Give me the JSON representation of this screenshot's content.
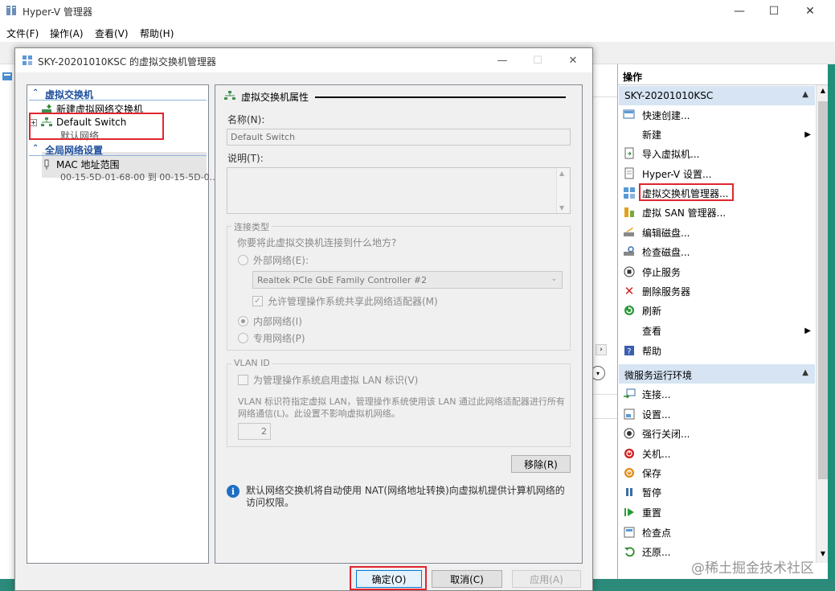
{
  "main_window": {
    "title": "Hyper-V 管理器",
    "menu": [
      "文件(F)",
      "操作(A)",
      "查看(V)",
      "帮助(H)"
    ],
    "controls": {
      "minimize": "—",
      "maximize": "☐",
      "close": "✕"
    }
  },
  "actions": {
    "header": "操作",
    "server_section": "SKY-20201010KSC",
    "server_items": [
      {
        "label": "快速创建...",
        "icon": "quick-create-icon",
        "submenu": false
      },
      {
        "label": "新建",
        "icon": "",
        "submenu": true
      },
      {
        "label": "导入虚拟机...",
        "icon": "import-icon",
        "submenu": false
      },
      {
        "label": "Hyper-V 设置...",
        "icon": "settings-doc-icon",
        "submenu": false
      },
      {
        "label": "虚拟交换机管理器...",
        "icon": "switch-manager-icon",
        "submenu": false
      },
      {
        "label": "虚拟 SAN 管理器...",
        "icon": "san-manager-icon",
        "submenu": false
      },
      {
        "label": "编辑磁盘...",
        "icon": "edit-disk-icon",
        "submenu": false
      },
      {
        "label": "检查磁盘...",
        "icon": "inspect-disk-icon",
        "submenu": false
      },
      {
        "label": "停止服务",
        "icon": "stop-service-icon",
        "submenu": false
      },
      {
        "label": "删除服务器",
        "icon": "delete-server-icon",
        "submenu": false
      },
      {
        "label": "刷新",
        "icon": "refresh-icon",
        "submenu": false
      },
      {
        "label": "查看",
        "icon": "",
        "submenu": true
      },
      {
        "label": "帮助",
        "icon": "help-icon",
        "submenu": false
      }
    ],
    "vm_section": "微服务运行环境",
    "vm_items": [
      {
        "label": "连接...",
        "icon": "connect-icon"
      },
      {
        "label": "设置...",
        "icon": "settings-icon"
      },
      {
        "label": "强行关闭...",
        "icon": "turn-off-icon"
      },
      {
        "label": "关机...",
        "icon": "shutdown-icon"
      },
      {
        "label": "保存",
        "icon": "save-icon"
      },
      {
        "label": "暂停",
        "icon": "pause-icon"
      },
      {
        "label": "重置",
        "icon": "reset-icon"
      },
      {
        "label": "检查点",
        "icon": "checkpoint-icon"
      },
      {
        "label": "还原...",
        "icon": "revert-icon"
      }
    ]
  },
  "dialog": {
    "title": "SKY-20201010KSC 的虚拟交换机管理器",
    "tree": {
      "switches_header": "虚拟交换机",
      "new_switch": "新建虚拟网络交换机",
      "default_switch": "Default Switch",
      "default_switch_sub": "默认网络",
      "global_header": "全局网络设置",
      "mac_range": "MAC 地址范围",
      "mac_range_sub": "00-15-5D-01-68-00 到 00-15-5D-0..."
    },
    "props": {
      "title": "虚拟交换机属性",
      "name_label": "名称(N):",
      "name_value": "Default Switch",
      "desc_label": "说明(T):",
      "conn_type_caption": "连接类型",
      "conn_question": "你要将此虚拟交换机连接到什么地方?",
      "external_label": "外部网络(E):",
      "adapter_value": "Realtek PCIe GbE Family Controller #2",
      "allow_share_label": "允许管理操作系统共享此网络适配器(M)",
      "internal_label": "内部网络(I)",
      "private_label": "专用网络(P)",
      "vlan_caption": "VLAN ID",
      "vlan_enable_label": "为管理操作系统启用虚拟 LAN 标识(V)",
      "vlan_desc": "VLAN 标识符指定虚拟 LAN，管理操作系统使用该 LAN 通过此网络适配器进行所有网络通信(L)。此设置不影响虚拟机网络。",
      "vlan_value": "2",
      "remove_button": "移除(R)",
      "info_text": "默认网络交换机将自动使用 NAT(网络地址转换)向虚拟机提供计算机网络的访问权限。"
    },
    "buttons": {
      "ok": "确定(O)",
      "cancel": "取消(C)",
      "apply": "应用(A)"
    }
  },
  "watermark": "@稀土掘金技术社区",
  "colors": {
    "highlight_red": "#e0262e",
    "tree_header": "#1e4f9c",
    "section_bar": "#d6e4f3"
  }
}
